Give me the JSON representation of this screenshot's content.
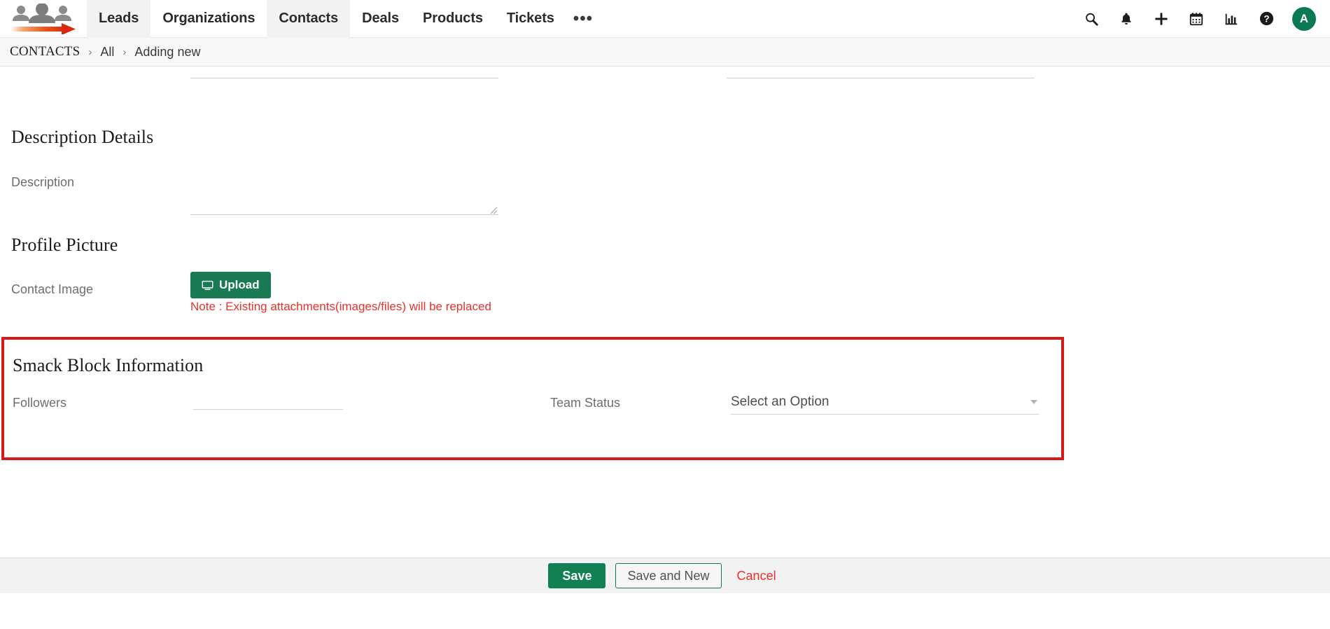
{
  "app": {
    "logo_name": "people-arrow-logo"
  },
  "nav": {
    "items": [
      {
        "label": "Leads",
        "active": false
      },
      {
        "label": "Organizations",
        "active": false
      },
      {
        "label": "Contacts",
        "active": true
      },
      {
        "label": "Deals",
        "active": false
      },
      {
        "label": "Products",
        "active": false
      },
      {
        "label": "Tickets",
        "active": false
      }
    ],
    "more_label": "•••",
    "right_icons": [
      "search-icon",
      "bell-icon",
      "plus-icon",
      "calendar-icon",
      "bar-chart-icon",
      "help-icon"
    ],
    "avatar_initial": "A"
  },
  "breadcrumb": {
    "root": "CONTACTS",
    "separator": "›",
    "items": [
      "All",
      "Adding new"
    ]
  },
  "form": {
    "cut_off_row": {
      "left_label": "",
      "right_label": ""
    },
    "description_section": {
      "title": "Description Details",
      "field_label": "Description",
      "field_value": "",
      "field_placeholder": ""
    },
    "profile_picture_section": {
      "title": "Profile Picture",
      "field_label": "Contact Image",
      "upload_button": "Upload",
      "upload_icon": "monitor-icon",
      "note": "Note : Existing attachments(images/files) will be replaced"
    },
    "smack_block_section": {
      "title": "Smack Block Information",
      "followers_label": "Followers",
      "followers_value": "",
      "followers_placeholder": "",
      "team_status_label": "Team Status",
      "team_status_value": "Select an Option"
    }
  },
  "footer": {
    "save_label": "Save",
    "save_and_new_label": "Save and New",
    "cancel_label": "Cancel"
  },
  "colors": {
    "brand_green": "#128053",
    "upload_green": "#1a7a54",
    "alert_red": "#e8312a",
    "highlight_border": "#d31b17",
    "avatar_green": "#0b7a54"
  }
}
